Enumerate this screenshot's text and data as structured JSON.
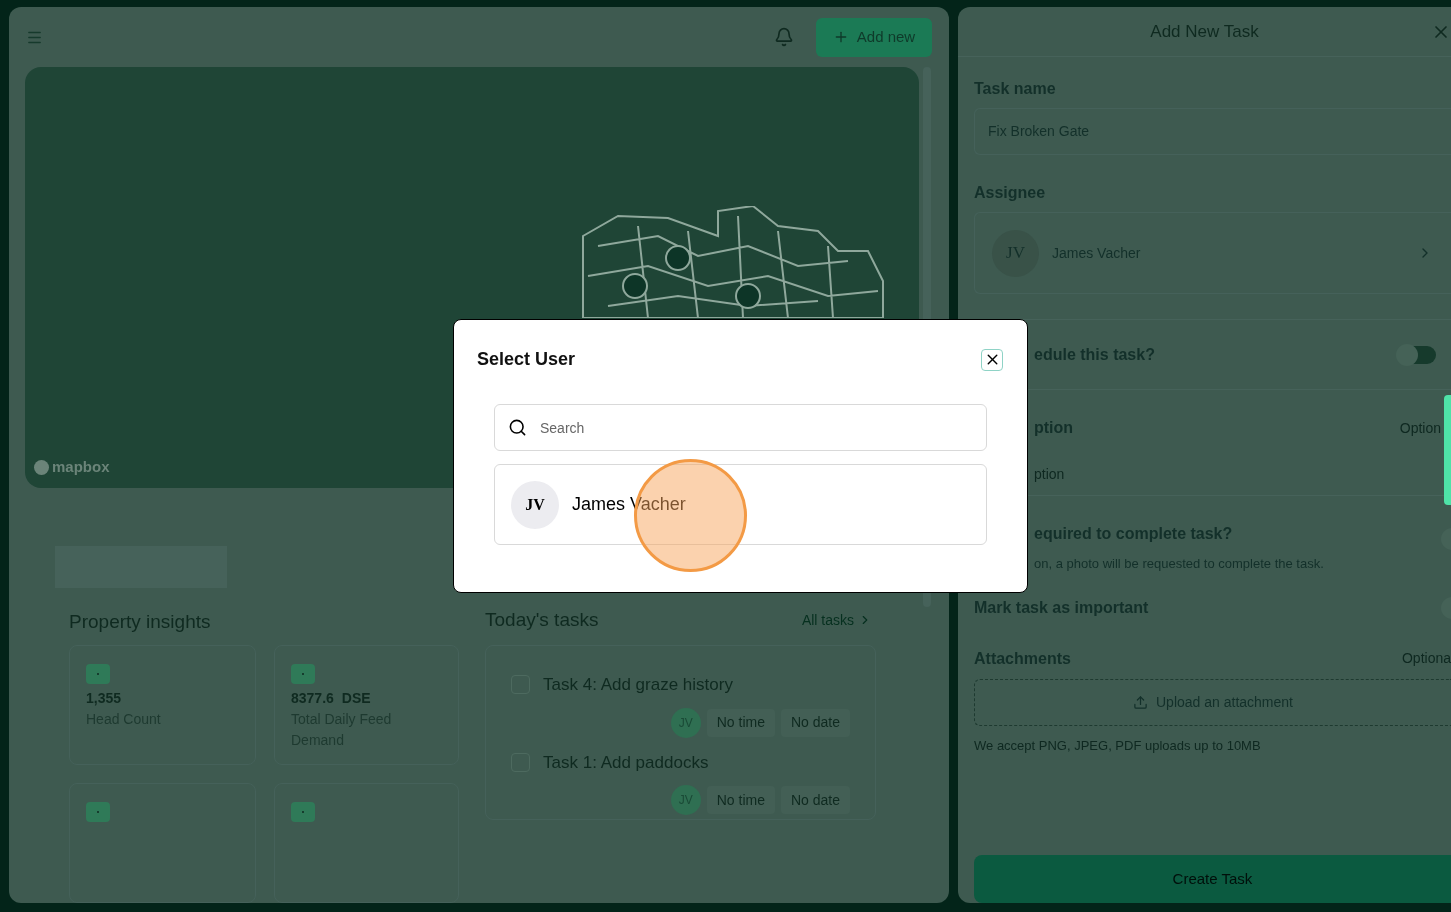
{
  "header": {
    "add_button": "Add new"
  },
  "map": {
    "attribution": "mapbox"
  },
  "insights": {
    "title": "Property insights",
    "cards": [
      {
        "kind": "stat",
        "value": "1,355",
        "label": "Head Count"
      },
      {
        "kind": "stat",
        "value": "8377.6",
        "unit": "DSE",
        "label": "Total Daily Feed Demand"
      },
      {
        "kind": "stat"
      },
      {
        "kind": "stat"
      }
    ]
  },
  "tasks": {
    "title": "Today's tasks",
    "link": "All tasks",
    "items": [
      {
        "title": "Task 4: Add graze history",
        "checked": false,
        "assignee": "JV",
        "time": "No time",
        "date": "No date"
      },
      {
        "title": "Task 1: Add paddocks",
        "checked": false,
        "assignee": "JV",
        "time": "No time",
        "date": "No date"
      }
    ]
  },
  "task_form": {
    "title": "Add New Task",
    "task_name": {
      "label": "Task name",
      "value": "Fix Broken Gate"
    },
    "assignee": {
      "label": "Assignee",
      "initials": "JV",
      "name": "James Vacher"
    },
    "schedule": {
      "label": "edule this task?",
      "on": false
    },
    "description": {
      "label": "ption",
      "hint": "Option",
      "placeholder": "ption"
    },
    "photo": {
      "label": "equired to complete task?",
      "note": "on, a photo will be requested to complete the task.",
      "on": false
    },
    "important": {
      "label": "Mark task as important",
      "on": false
    },
    "attachments": {
      "label": "Attachments",
      "hint": "Optiona",
      "upload": "Upload an attachment",
      "note": "We accept PNG, JPEG, PDF uploads up to 10MB"
    },
    "submit": "Create Task"
  },
  "select_user": {
    "title": "Select User",
    "search": {
      "placeholder": "Search"
    },
    "users": [
      {
        "initials": "JV",
        "name": "James Vacher",
        "selected": false
      }
    ]
  }
}
